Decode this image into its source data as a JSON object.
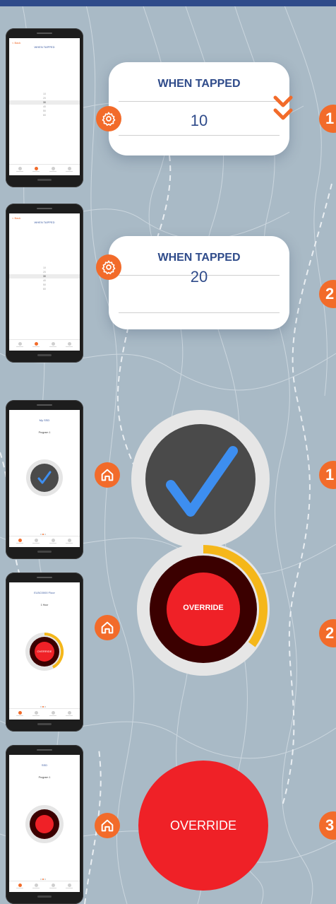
{
  "cards": [
    {
      "title": "WHEN TAPPED",
      "value": "10",
      "icon": "gear-icon"
    },
    {
      "title": "WHEN TAPPED",
      "value": "20",
      "icon": "gear-icon"
    }
  ],
  "override": {
    "dial_label": "OVERRIDE",
    "button_label": "OVERRIDE"
  },
  "steps": [
    "1",
    "2",
    "1",
    "2",
    "3"
  ],
  "phones": {
    "back_label": "< Back",
    "settings_title": "WHEN TAPPED",
    "list_1": [
      "10",
      "20",
      "30",
      "40",
      "50",
      "60",
      "70"
    ],
    "list_2": [
      "10",
      "20",
      "30",
      "40",
      "50",
      "60",
      "70"
    ],
    "home_title_1": "My SSD",
    "home_sub_1": "Program 1",
    "home_title_2": "ELBC0000 Floor",
    "home_sub_2": "1 Hour",
    "home_title_3": "SSD",
    "home_sub_3": "Program 1",
    "mini_override": "OVERRIDE"
  },
  "colors": {
    "accent": "#f26b2a",
    "brand_blue": "#2f4b8a",
    "check_blue": "#3d8ef0",
    "override_red": "#ef2127",
    "dark_red": "#3b0000",
    "progress_yellow": "#f5b71a",
    "dial_dark": "#4a4a4a"
  },
  "progress": {
    "override_ring_fraction": 0.35
  }
}
